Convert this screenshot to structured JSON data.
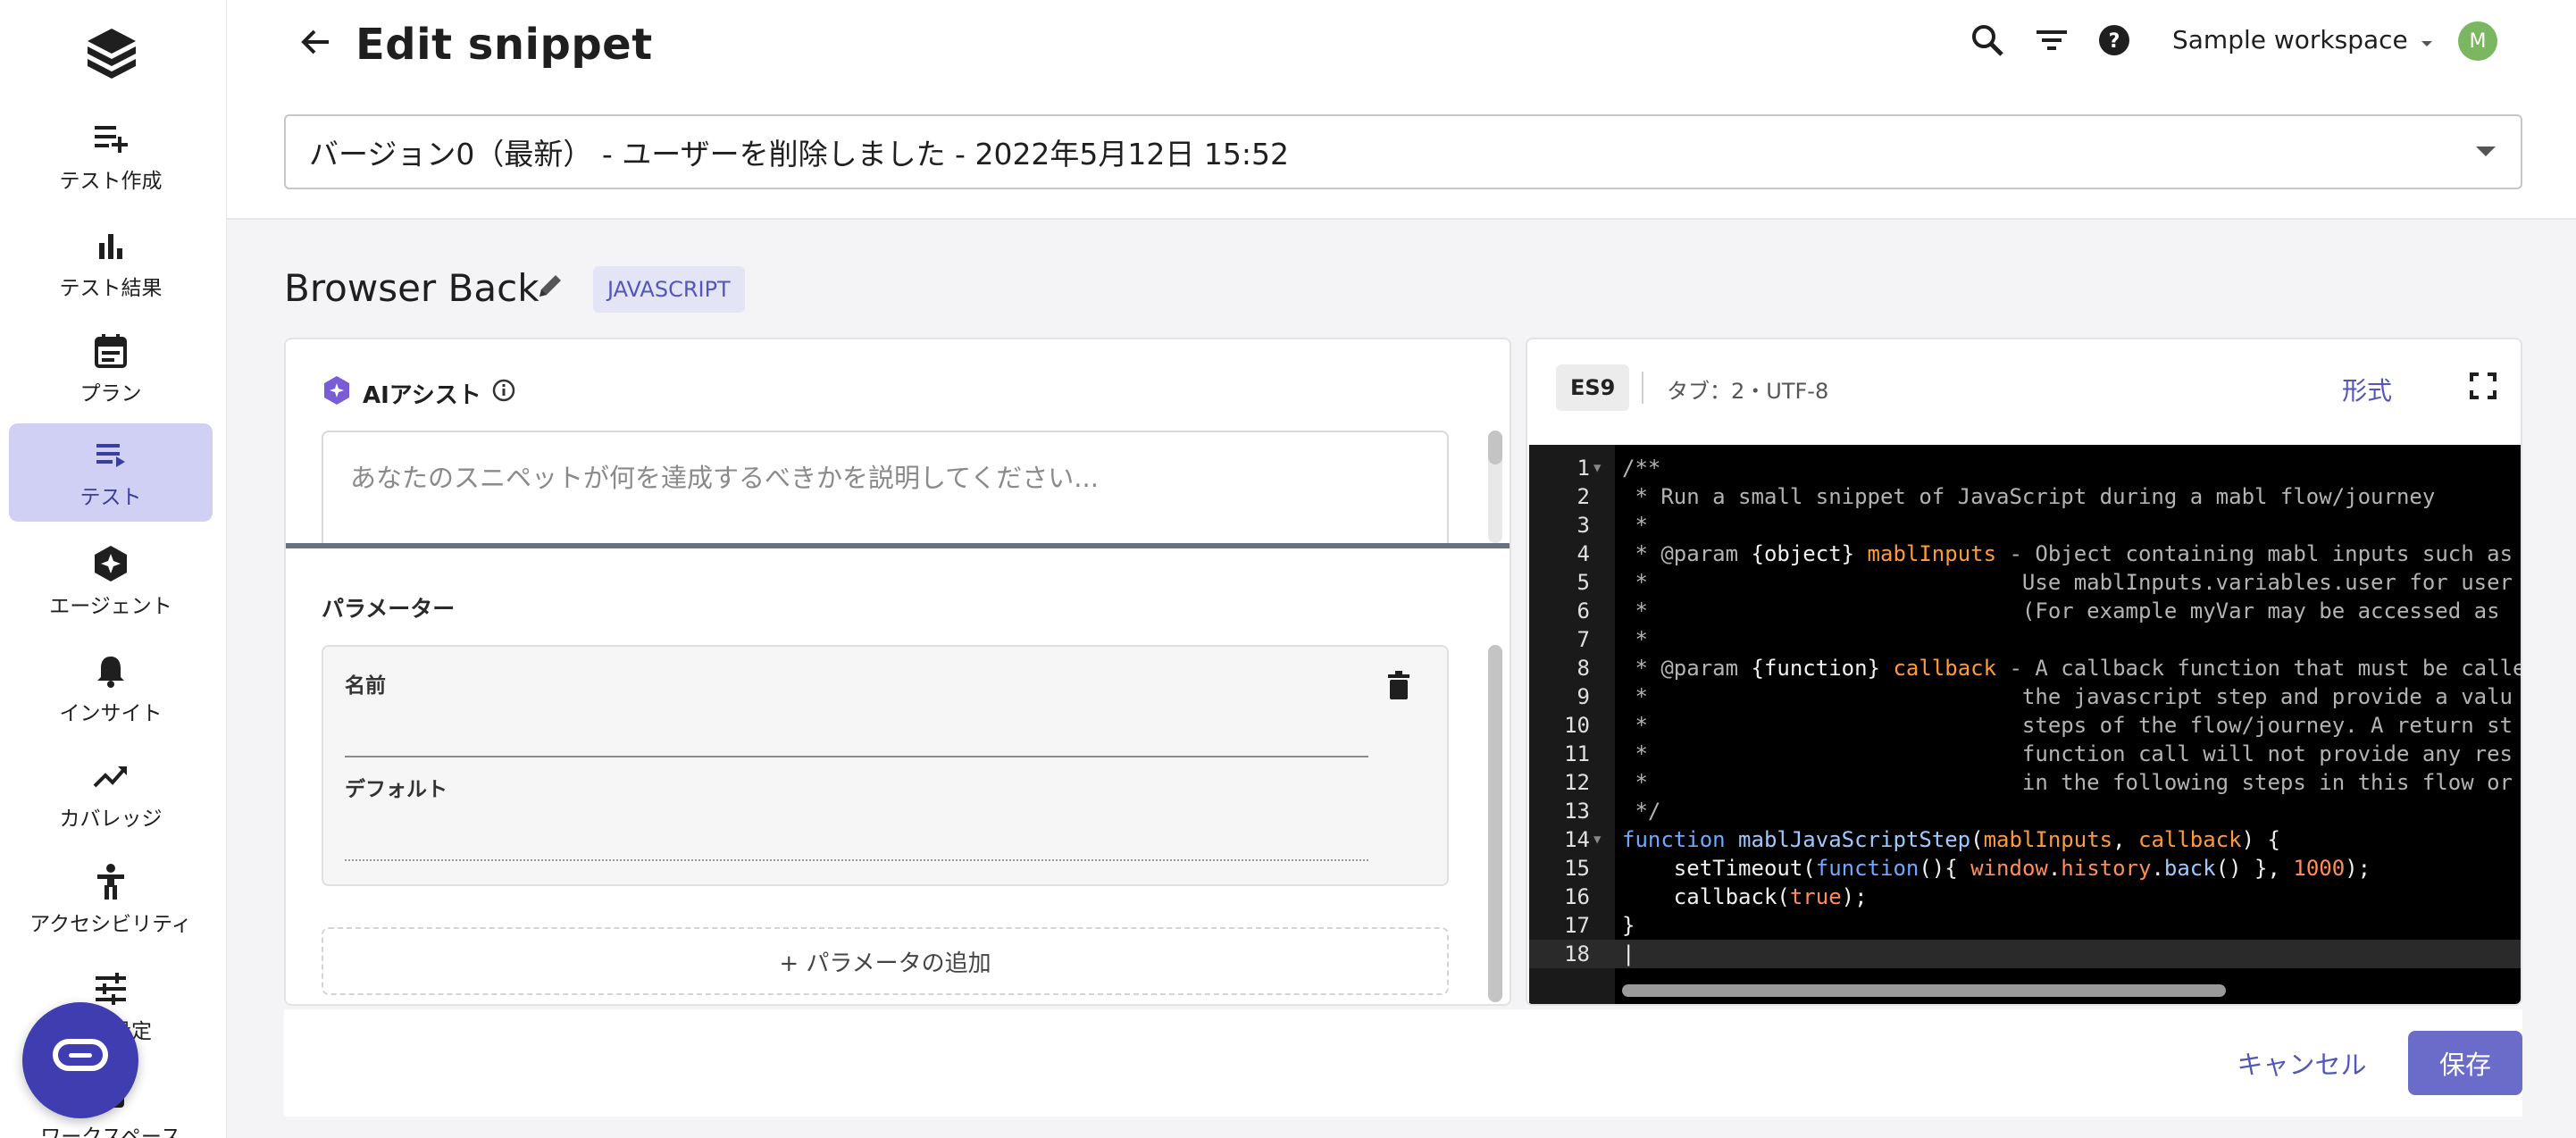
{
  "sidebar": {
    "logo": "mabl-logo",
    "items": [
      {
        "label": "テスト作成",
        "icon": "playlist-add-icon"
      },
      {
        "label": "テスト結果",
        "icon": "bar-chart-icon"
      },
      {
        "label": "プラン",
        "icon": "calendar-icon"
      },
      {
        "label": "テスト",
        "icon": "test-list-icon",
        "active": true
      },
      {
        "label": "エージェント",
        "icon": "agent-sparkle-icon"
      },
      {
        "label": "インサイト",
        "icon": "bell-icon"
      },
      {
        "label": "カバレッジ",
        "icon": "trending-up-icon"
      },
      {
        "label": "アクセシビリティ",
        "icon": "accessibility-icon"
      },
      {
        "label": "環境設定",
        "icon": "tune-icon"
      },
      {
        "label": "ワークスペース",
        "icon": "workspace-icon"
      }
    ],
    "chat_icon": "chat-icon"
  },
  "header": {
    "title": "Edit snippet",
    "workspace": "Sample workspace",
    "avatar_initial": "M"
  },
  "version": {
    "selected": "バージョン0（最新） - ユーザーを削除しました - 2022年5月12日 15:52"
  },
  "snippet": {
    "name": "Browser Back",
    "language_badge": "JAVASCRIPT"
  },
  "ai_assist": {
    "title": "AIアシスト",
    "placeholder": "あなたのスニペットが何を達成するべきかを説明してください..."
  },
  "parameters": {
    "title": "パラメーター",
    "name_label": "名前",
    "default_label": "デフォルト",
    "add_label": "+ パラメータの追加"
  },
  "editor": {
    "es_badge": "ES9",
    "tab_info": "タブ：2・UTF-8",
    "format_label": "形式",
    "line_numbers": [
      "1",
      "2",
      "3",
      "4",
      "5",
      "6",
      "7",
      "8",
      "9",
      "10",
      "11",
      "12",
      "13",
      "14",
      "15",
      "16",
      "17",
      "18"
    ]
  },
  "footer": {
    "cancel_label": "キャンセル",
    "save_label": "保存"
  },
  "colors": {
    "accent": "#5456b8",
    "active_nav": "#cfd0f3",
    "save_button": "#6b6bc9",
    "chat_fab": "#3f3db0",
    "avatar": "#7bb661"
  }
}
